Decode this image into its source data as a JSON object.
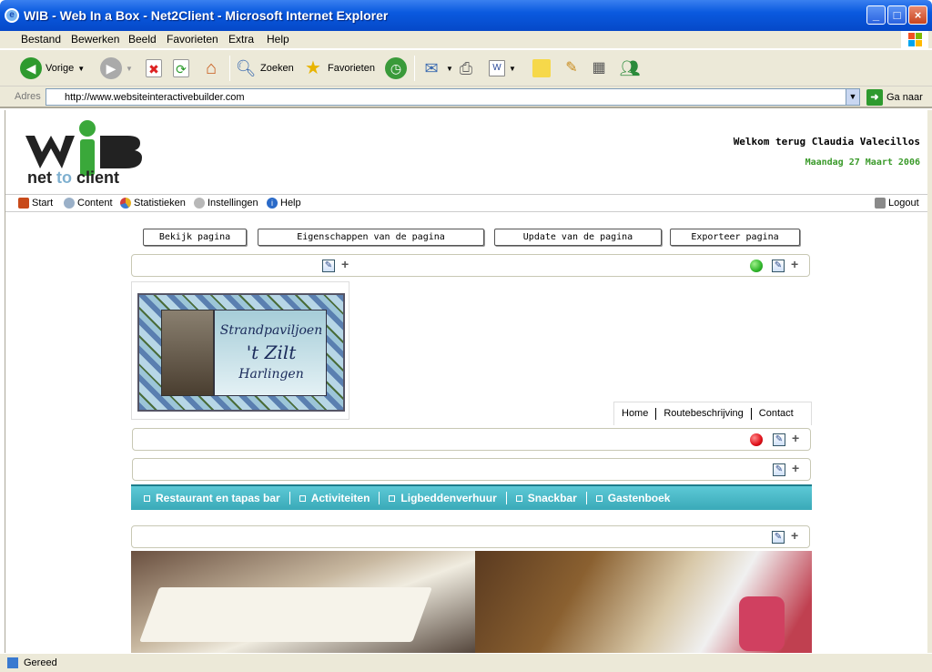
{
  "window": {
    "title": "WIB - Web In a Box - Net2Client - Microsoft Internet Explorer"
  },
  "menu": [
    "Bestand",
    "Bewerken",
    "Beeld",
    "Favorieten",
    "Extra",
    "Help"
  ],
  "toolbar": {
    "back": "Vorige",
    "search": "Zoeken",
    "favorites": "Favorieten"
  },
  "address": {
    "label": "Adres",
    "url": "http://www.websiteinteractivebuilder.com",
    "go": "Ga naar"
  },
  "header": {
    "logo_text": "WIB",
    "logo_tagline_a": "net",
    "logo_tagline_b": "to",
    "logo_tagline_c": "client",
    "welcome": "Welkom terug Claudia Valecillos",
    "date": "Maandag 27 Maart 2006"
  },
  "appnav": {
    "start": "Start",
    "content": "Content",
    "stats": "Statistieken",
    "settings": "Instellingen",
    "help": "Help",
    "logout": "Logout"
  },
  "actions": {
    "view": "Bekijk pagina",
    "properties": "Eigenschappen van de pagina",
    "update": "Update van de pagina",
    "export": "Exporteer pagina"
  },
  "banner": {
    "line1": "Strandpaviljoen",
    "line2": "'t Zilt",
    "line3": "Harlingen"
  },
  "sitenav": [
    "Home",
    "Routebeschrijving",
    "Contact"
  ],
  "sitemenu": [
    "Restaurant en tapas bar",
    "Activiteiten",
    "Ligbeddenverhuur",
    "Snackbar",
    "Gastenboek"
  ],
  "status": {
    "text": "Gereed"
  },
  "colors": {
    "green_status": "#2fb52a",
    "red_status": "#e0101a",
    "teal_menu": "#3fb5c4",
    "date_green": "#3a9a2a"
  }
}
